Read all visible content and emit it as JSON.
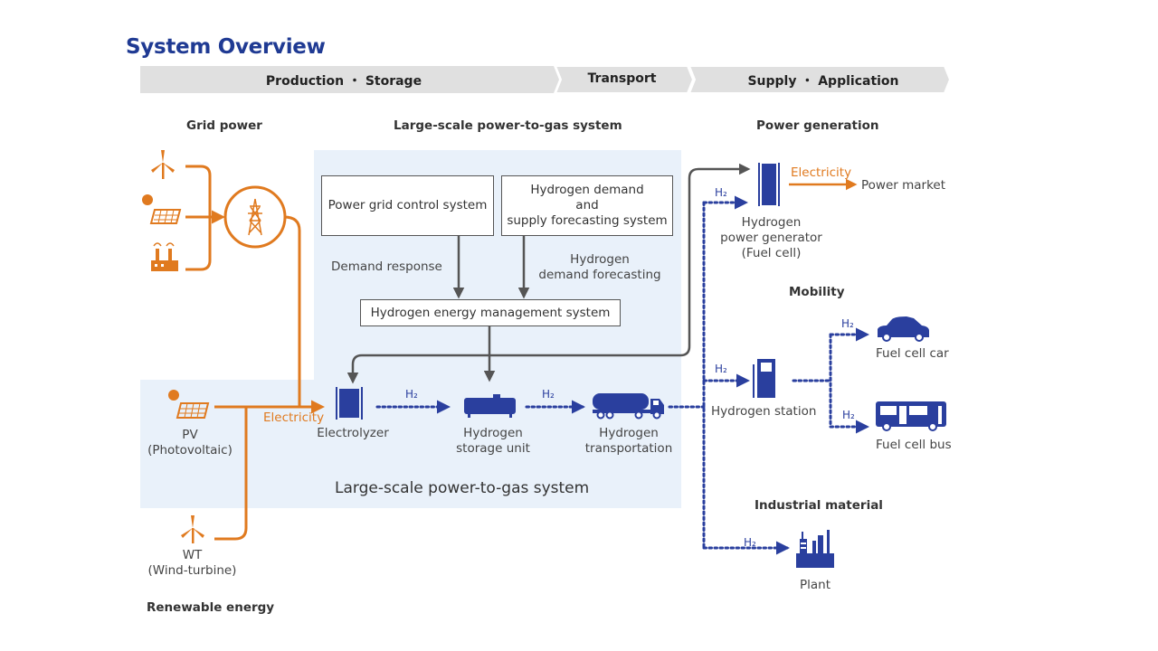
{
  "title": "System Overview",
  "phases": [
    "Production ・ Storage",
    "Transport",
    "Supply ・ Application"
  ],
  "sections": {
    "grid_power": "Grid power",
    "p2g_top": "Large-scale power-to-gas system",
    "power_generation": "Power generation",
    "mobility": "Mobility",
    "industrial": "Industrial material",
    "renewable": "Renewable energy",
    "p2g_bottom": "Large-scale power-to-gas system"
  },
  "boxes": {
    "grid_control": "Power grid control system",
    "forecast_system": [
      "Hydrogen demand",
      "and",
      "supply forecasting system"
    ],
    "hems": "Hydrogen energy management system"
  },
  "flow_labels": {
    "demand_response": "Demand response",
    "demand_forecasting": [
      "Hydrogen",
      "demand forecasting"
    ],
    "electricity": "Electricity",
    "h2": "H₂"
  },
  "nodes": {
    "pv": [
      "PV",
      "(Photovoltaic)"
    ],
    "wt": [
      "WT",
      "(Wind-turbine)"
    ],
    "electrolyzer": "Electrolyzer",
    "storage": [
      "Hydrogen",
      "storage unit"
    ],
    "transportation": [
      "Hydrogen",
      "transportation"
    ],
    "fuel_cell": [
      "Hydrogen",
      "power generator",
      "(Fuel cell)"
    ],
    "power_market": "Power market",
    "station": "Hydrogen station",
    "car": "Fuel cell car",
    "bus": "Fuel cell bus",
    "plant": "Plant"
  },
  "colors": {
    "title": "#1f3a93",
    "electricity": "#e07a1f",
    "hydrogen": "#2a3f9e",
    "panel": "#e9f1fa",
    "header_bar": "#e0e0e0"
  }
}
